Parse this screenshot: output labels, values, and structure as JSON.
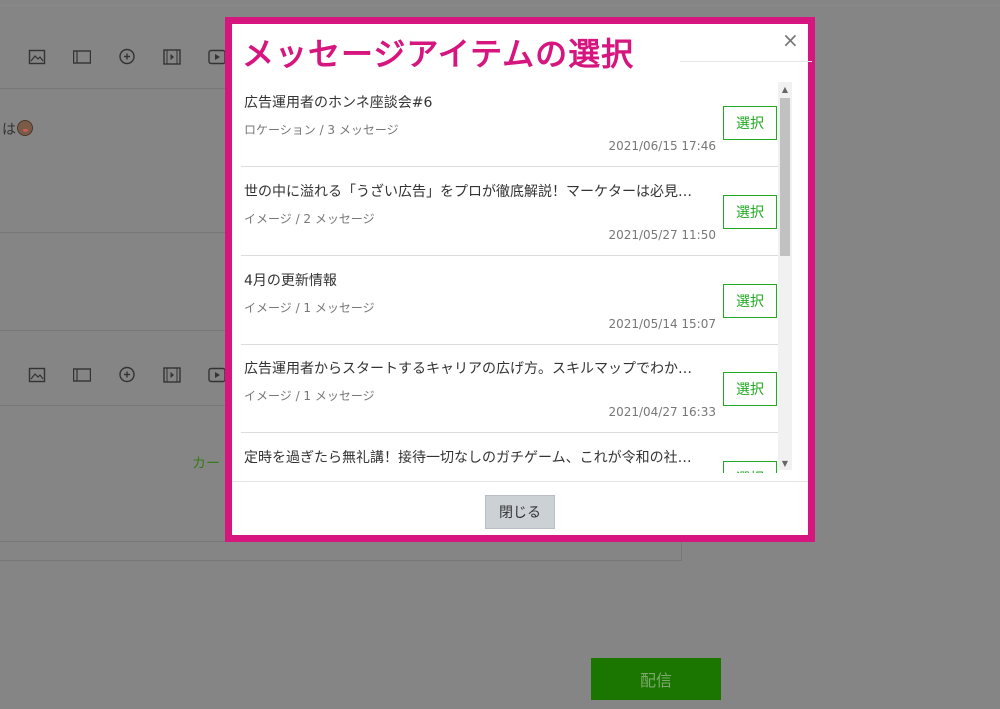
{
  "modal": {
    "title": "メッセージアイテムの選択",
    "close_glyph": "×",
    "footer_close_label": "閉じる",
    "select_label": "選択",
    "items": [
      {
        "title": "広告運用者のホンネ座談会#6",
        "meta": "ロケーション / 3 メッセージ",
        "date": "2021/06/15 17:46"
      },
      {
        "title": "世の中に溢れる「うざい広告」をプロが徹底解説！マーケターは必見…",
        "meta": "イメージ / 2 メッセージ",
        "date": "2021/05/27 11:50"
      },
      {
        "title": "4月の更新情報",
        "meta": "イメージ / 1 メッセージ",
        "date": "2021/05/14 15:07"
      },
      {
        "title": "広告運用者からスタートするキャリアの広げ方。スキルマップでわか…",
        "meta": "イメージ / 1 メッセージ",
        "date": "2021/04/27 16:33"
      },
      {
        "title": "定時を過ぎたら無礼講！接待一切なしのガチゲーム、これが令和の社…",
        "meta": "",
        "date": ""
      }
    ]
  },
  "background": {
    "fragment_text": "は",
    "green_text": "カー",
    "send_label": "配信"
  },
  "colors": {
    "accent": "#d6157f",
    "select_green": "#22aa22",
    "send_green": "#1a7600"
  },
  "icons": [
    "image-icon",
    "card-icon",
    "sticker-icon",
    "video-icon",
    "play-icon"
  ]
}
